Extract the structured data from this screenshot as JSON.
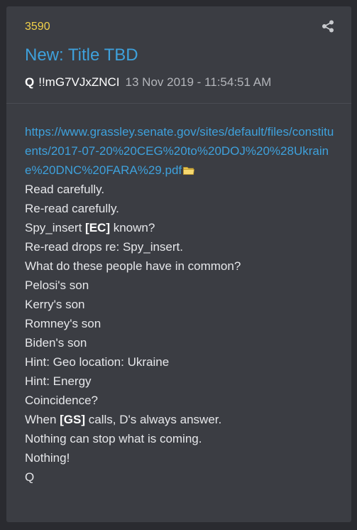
{
  "post": {
    "number": "3590",
    "title": "New: Title TBD",
    "author": "Q",
    "tripcode": "!!mG7VJxZNCI",
    "timestamp": "13 Nov 2019 - 11:54:51 AM"
  },
  "body": {
    "link_text": "https://www.grassley.senate.gov/sites/default/files/constituents/2017-07-20%20CEG%20to%20DOJ%20%28Ukraine%20DNC%20FARA%29.pdf",
    "lines": {
      "l1": "Read carefully.",
      "l2": "Re-read carefully.",
      "l3_pre": "Spy_insert ",
      "l3_bold": "[EC]",
      "l3_post": " known?",
      "l4": "Re-read drops re: Spy_insert.",
      "l5": "What do these people have in common?",
      "l6": "Pelosi's son",
      "l7": "Kerry's son",
      "l8": "Romney's son",
      "l9": "Biden's son",
      "l10": "Hint: Geo location: Ukraine",
      "l11": "Hint: Energy",
      "l12": "Coincidence?",
      "l13_pre": "When ",
      "l13_bold": "[GS]",
      "l13_post": " calls, D's always answer.",
      "l14": "Nothing can stop what is coming.",
      "l15": "Nothing!",
      "l16": "Q"
    }
  },
  "icons": {
    "share": "share-icon",
    "folder": "folder-icon"
  },
  "colors": {
    "background": "#2a2b30",
    "card": "#3b3d43",
    "post_number": "#f1d14a",
    "title": "#3ea1dc",
    "link": "#3ea1dc",
    "text": "#e6e7ea",
    "timestamp": "#b3b5ba"
  }
}
